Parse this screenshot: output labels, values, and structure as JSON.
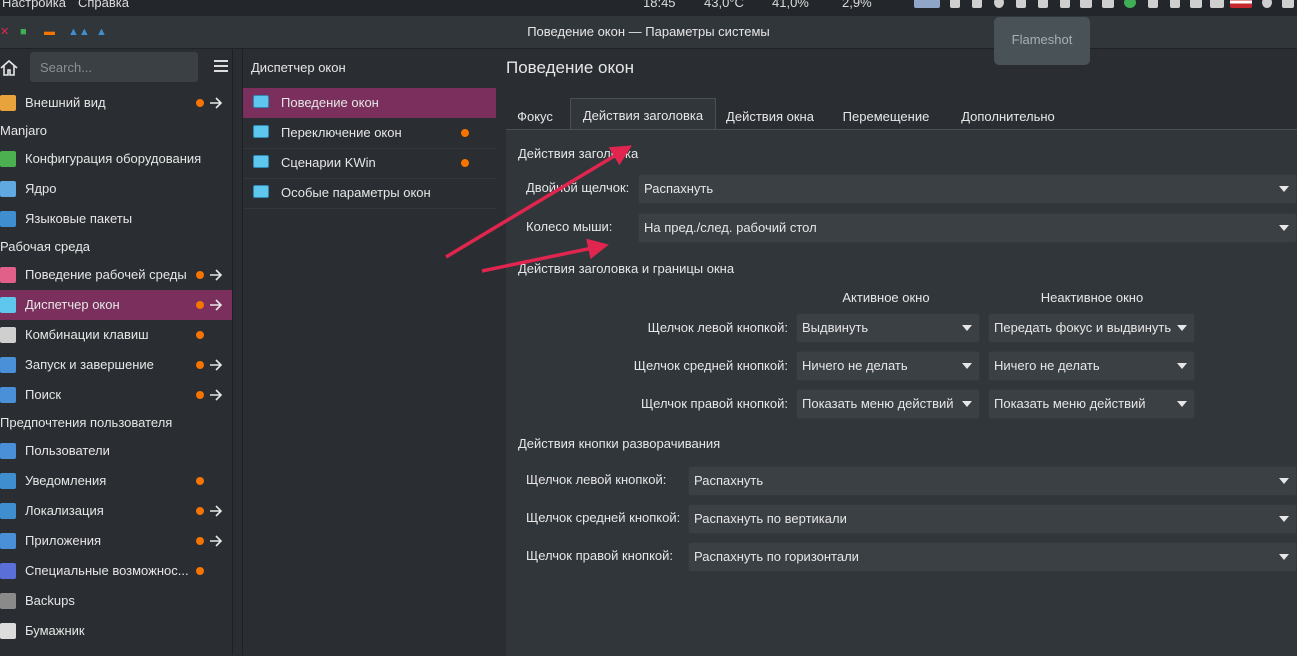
{
  "system_bar": {
    "menu": [
      "Настройка",
      "Справка"
    ],
    "clock": "18:45",
    "temperature": "43,0°C",
    "stat1": "41,0%",
    "stat2": "2,9%"
  },
  "window": {
    "title": "Поведение окон — Параметры системы"
  },
  "tooltip": {
    "text": "Flameshot"
  },
  "sidebar": {
    "search_placeholder": "Search...",
    "rows": [
      {
        "type": "item",
        "label": "Внешний вид",
        "icon": "appearance-icon",
        "icon_color": "#e8a33d",
        "dot": true,
        "arrow": true
      },
      {
        "type": "category",
        "label": "Manjaro"
      },
      {
        "type": "item",
        "label": "Конфигурация оборудования",
        "icon": "hardware-icon",
        "icon_color": "#4caf50",
        "dot": false,
        "arrow": false
      },
      {
        "type": "item",
        "label": "Ядро",
        "icon": "kernel-icon",
        "icon_color": "#5fa8e0",
        "dot": false,
        "arrow": false
      },
      {
        "type": "item",
        "label": "Языковые пакеты",
        "icon": "language-packs-icon",
        "icon_color": "#3f8fd0",
        "dot": false,
        "arrow": false
      },
      {
        "type": "category",
        "label": "Рабочая среда"
      },
      {
        "type": "item",
        "label": "Поведение рабочей среды",
        "icon": "workspace-icon",
        "icon_color": "#e0608a",
        "dot": true,
        "arrow": true
      },
      {
        "type": "item",
        "label": "Диспетчер окон",
        "icon": "window-manager-icon",
        "icon_color": "#5fc6ee",
        "dot": true,
        "arrow": true,
        "selected": true
      },
      {
        "type": "item",
        "label": "Комбинации клавиш",
        "icon": "shortcuts-icon",
        "icon_color": "#cfcfcf",
        "dot": true,
        "arrow": false
      },
      {
        "type": "item",
        "label": "Запуск и завершение",
        "icon": "startup-icon",
        "icon_color": "#4a90d9",
        "dot": true,
        "arrow": true
      },
      {
        "type": "item",
        "label": "Поиск",
        "icon": "search-icon",
        "icon_color": "#4a90d9",
        "dot": true,
        "arrow": true
      },
      {
        "type": "category",
        "label": "Предпочтения пользователя"
      },
      {
        "type": "item",
        "label": "Пользователи",
        "icon": "users-icon",
        "icon_color": "#4a90d9",
        "dot": false,
        "arrow": false
      },
      {
        "type": "item",
        "label": "Уведомления",
        "icon": "notifications-icon",
        "icon_color": "#3f8fd0",
        "dot": true,
        "arrow": false
      },
      {
        "type": "item",
        "label": "Локализация",
        "icon": "locale-icon",
        "icon_color": "#3f8fd0",
        "dot": true,
        "arrow": true
      },
      {
        "type": "item",
        "label": "Приложения",
        "icon": "applications-icon",
        "icon_color": "#4a90d9",
        "dot": true,
        "arrow": true
      },
      {
        "type": "item",
        "label": "Специальные возможнос...",
        "icon": "accessibility-icon",
        "icon_color": "#5b6fd8",
        "dot": true,
        "arrow": false
      },
      {
        "type": "item",
        "label": "Backups",
        "icon": "backups-icon",
        "icon_color": "#8a8a8a",
        "dot": false,
        "arrow": false
      },
      {
        "type": "item",
        "label": "Бумажник",
        "icon": "wallet-icon",
        "icon_color": "#dcdcdc",
        "dot": false,
        "arrow": false
      }
    ]
  },
  "middle": {
    "title": "Диспетчер окон",
    "items": [
      {
        "label": "Поведение окон",
        "selected": true,
        "dot": false
      },
      {
        "label": "Переключение окон",
        "selected": false,
        "dot": true
      },
      {
        "label": "Сценарии KWin",
        "selected": false,
        "dot": true
      },
      {
        "label": "Особые параметры окон",
        "selected": false,
        "dot": false
      }
    ]
  },
  "main": {
    "title": "Поведение окон",
    "tabs": [
      "Фокус",
      "Действия заголовка",
      "Действия окна",
      "Перемещение",
      "Дополнительно"
    ],
    "active_tab": 1,
    "sec1": {
      "title": "Действия заголовка",
      "double_click_label": "Двойной щелчок:",
      "double_click_value": "Распахнуть",
      "wheel_label": "Колесо мыши:",
      "wheel_value": "На пред./след. рабочий стол"
    },
    "sec2": {
      "title": "Действия заголовка и границы окна",
      "col_active": "Активное окно",
      "col_inactive": "Неактивное окно",
      "rows": [
        {
          "label": "Щелчок левой кнопкой:",
          "active": "Выдвинуть",
          "inactive": "Передать фокус и выдвинуть"
        },
        {
          "label": "Щелчок средней кнопкой:",
          "active": "Ничего не делать",
          "inactive": "Ничего не делать"
        },
        {
          "label": "Щелчок правой кнопкой:",
          "active": "Показать меню действий",
          "inactive": "Показать меню действий"
        }
      ]
    },
    "sec3": {
      "title": "Действия кнопки разворачивания",
      "rows": [
        {
          "label": "Щелчок левой кнопкой:",
          "value": "Распахнуть"
        },
        {
          "label": "Щелчок средней кнопкой:",
          "value": "Распахнуть по вертикали"
        },
        {
          "label": "Щелчок правой кнопкой:",
          "value": "Распахнуть по горизонтали"
        }
      ]
    }
  },
  "colors": {
    "accent": "#7a2f5c",
    "dot": "#f67400",
    "annotation_arrow": "#e0264e"
  }
}
